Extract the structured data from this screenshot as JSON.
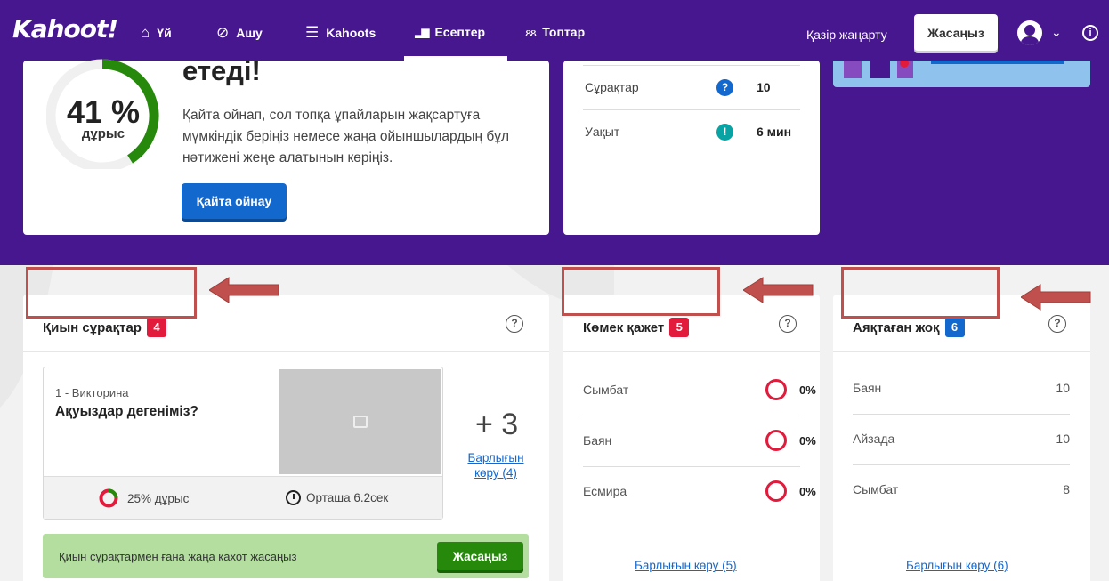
{
  "nav": {
    "logo": "Kahoot!",
    "items": [
      {
        "label": "Үй",
        "icon": "home-icon",
        "glyph": "⌂"
      },
      {
        "label": "Ашу",
        "icon": "compass-icon",
        "glyph": "⊘"
      },
      {
        "label": "Kahoots",
        "icon": "list-icon",
        "glyph": "☰"
      },
      {
        "label": "Есептер",
        "icon": "reports-icon",
        "glyph": "▂▆"
      },
      {
        "label": "Топтар",
        "icon": "groups-icon",
        "glyph": "ጸጸ"
      }
    ],
    "active": "Есептер",
    "refresh": "Қазір жаңарту",
    "create": "Жасаңыз"
  },
  "summary": {
    "percent": "41 %",
    "percent_label": "дұрыс",
    "accuracy_fraction": 0.41,
    "headline": "етеді!",
    "description": "Қайта ойнап, сол топқа ұпайларын жақсартуға мүмкіндік беріңіз немесе жаңа ойыншылардың бұл нәтижені жеңе алатынын көріңіз.",
    "replay_button": "Қайта ойнау"
  },
  "stats": [
    {
      "label": "Сұрақтар",
      "value": "10",
      "icon": "question-icon",
      "glyph": "?",
      "color": "#1368ce"
    },
    {
      "label": "Уақыт",
      "value": "6 мин",
      "icon": "time-icon",
      "glyph": "!",
      "color": "#0aa3a3"
    }
  ],
  "difficult": {
    "title": "Қиын сұрақтар",
    "count": "4",
    "badge_color": "#e21b3c",
    "question": {
      "number": "1 - Викторина",
      "title": "Ақуыздар дегеніміз?",
      "accuracy": "25% дұрыс",
      "average": "Орташа 6.2сек"
    },
    "more": "+ 3",
    "see_all": "Барлығын көру (4)",
    "new_kahoot_text": "Қиын сұрақтармен ғана жаңа кахот жасаңыз",
    "new_kahoot_button": "Жасаңыз"
  },
  "need_help": {
    "title": "Көмек қажет",
    "count": "5",
    "badge_color": "#e21b3c",
    "players": [
      {
        "name": "Сымбат",
        "value": "0%"
      },
      {
        "name": "Баян",
        "value": "0%"
      },
      {
        "name": "Есмира",
        "value": "0%"
      }
    ],
    "see_all": "Барлығын көру (5)"
  },
  "not_finished": {
    "title": "Аяқтаған жоқ",
    "count": "6",
    "badge_color": "#1368ce",
    "players": [
      {
        "name": "Баян",
        "value": "10"
      },
      {
        "name": "Айзада",
        "value": "10"
      },
      {
        "name": "Сымбат",
        "value": "8"
      }
    ],
    "see_all": "Барлығын көру (6)"
  },
  "help_icon": "?"
}
